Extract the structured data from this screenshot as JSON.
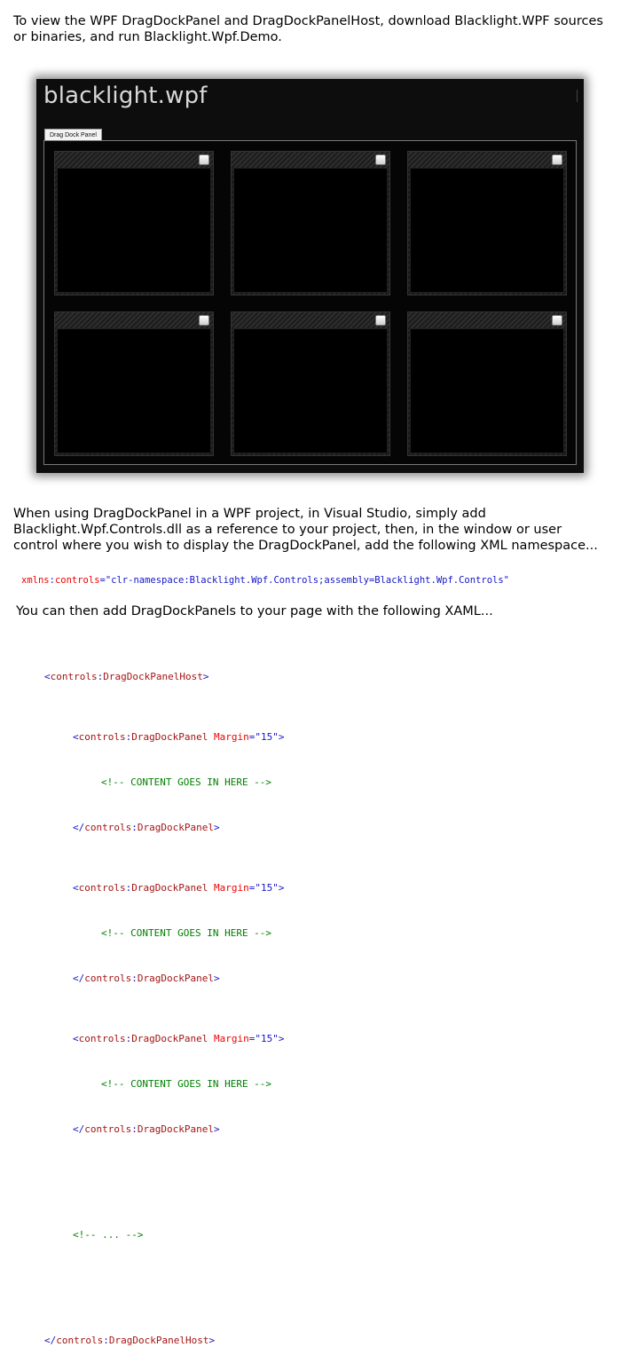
{
  "intro_text": "To view the WPF DragDockPanel and DragDockPanelHost, download Blacklight.WPF sources or binaries, and run Blacklight.Wpf.Demo.",
  "demo": {
    "logo_text": "blacklight.wpf",
    "tab_label": "Drag Dock Panel",
    "panel_count": 6
  },
  "usage_text": "When using DragDockPanel in a WPF project, in Visual Studio, simply add Blacklight.Wpf.Controls.dll as a reference to your project, then, in the window or user control where you wish to display the DragDockPanel, add the following XML namespace...",
  "namespace_line": {
    "prefix": "xmlns",
    "colon": ":",
    "name": "controls",
    "eq": "=",
    "value": "\"clr-namespace:Blacklight.Wpf.Controls;assembly=Blacklight.Wpf.Controls\""
  },
  "then_text": "You can then add DragDockPanels to your page with the following XAML...",
  "xaml": {
    "lt": "<",
    "gt": ">",
    "close_open": "</",
    "prefix": "controls",
    "colon": ":",
    "host_element": "DragDockPanelHost",
    "panel_element": "DragDockPanel",
    "margin_attr": "Margin",
    "eq": "=",
    "margin_value": "\"15\"",
    "content_comment": "<!-- CONTENT GOES IN HERE -->",
    "ellipsis_comment": "<!-- ... -->"
  },
  "colors": {
    "bracket": "#1515c8",
    "element": "#a31515",
    "attribute": "#ee0000",
    "value": "#1515c8",
    "comment": "#008000"
  }
}
